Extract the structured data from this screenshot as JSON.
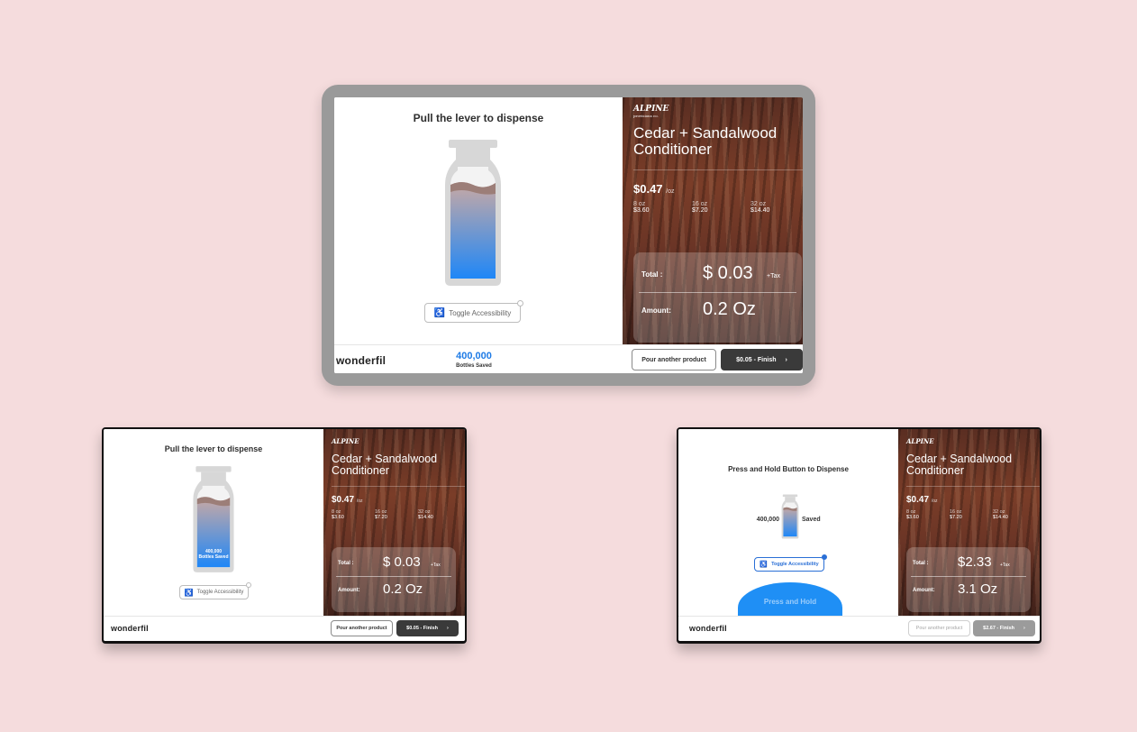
{
  "product": {
    "brand": "ALPINE",
    "brand_sub": "provisions co.",
    "name": "Cedar + Sandalwood Conditioner",
    "price": "$0.47",
    "price_unit": "/oz",
    "sizes": [
      {
        "label": "8 oz",
        "price": "$3.60"
      },
      {
        "label": "16 oz",
        "price": "$7.20"
      },
      {
        "label": "32 oz",
        "price": "$14.40"
      }
    ]
  },
  "screens": {
    "main": {
      "title": "Pull the lever to dispense",
      "accessibility": "Toggle Accessibility",
      "total_label": "Total :",
      "total_value": "$ 0.03",
      "tax": "+Tax",
      "amount_label": "Amount:",
      "amount_value": "0.2 Oz",
      "saved_count": "400,000",
      "saved_label": "Bottles Saved",
      "logo": "wonderfil",
      "pour_another": "Pour another product",
      "finish": "$0.05 - Finish",
      "finish_arrow": "›"
    },
    "left": {
      "title": "Pull the lever to dispense",
      "bottle_count": "400,000",
      "bottle_label": "Bottles Saved",
      "accessibility": "Toggle Accessibility",
      "total_label": "Total :",
      "total_value": "$ 0.03",
      "tax": "+Tax",
      "amount_label": "Amount:",
      "amount_value": "0.2 Oz",
      "logo": "wonderfil",
      "pour_another": "Pour another product",
      "finish": "$0.05 - Finish",
      "finish_arrow": "›"
    },
    "right": {
      "title": "Press and Hold Button to Dispense",
      "saved_count": "400,000",
      "saved_label": "Saved",
      "accessibility": "Toggle Accessibility",
      "hold_label": "Press and Hold",
      "total_label": "Total :",
      "total_value": "$2.33",
      "tax": "+Tax",
      "amount_label": "Amount:",
      "amount_value": "3.1 Oz",
      "logo": "wonderfil",
      "pour_another": "Pour another product",
      "finish": "$2.67 - Finish",
      "finish_arrow": "›"
    }
  },
  "colors": {
    "background": "#f5dcdd",
    "accent": "#1e7be6",
    "dark_button": "#3a3a3a",
    "wood": "#6b3526"
  }
}
